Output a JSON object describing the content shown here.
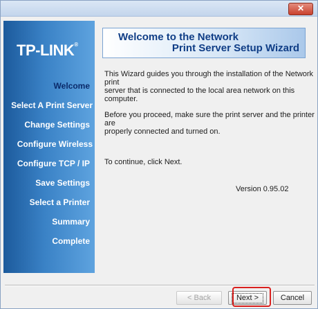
{
  "window": {
    "close_label": "✕"
  },
  "sidebar": {
    "logo": "TP-LINK",
    "logo_mark": "®",
    "steps": [
      {
        "label": "Welcome",
        "active": true
      },
      {
        "label": "Select A Print Server"
      },
      {
        "label": "Change Settings"
      },
      {
        "label": "Configure Wireless"
      },
      {
        "label": "Configure TCP / IP"
      },
      {
        "label": "Save Settings"
      },
      {
        "label": "Select a Printer"
      },
      {
        "label": "Summary"
      },
      {
        "label": "Complete"
      }
    ]
  },
  "header": {
    "title_line1": "Welcome to the Network",
    "title_line2": "Print Server Setup Wizard"
  },
  "body": {
    "para1_line1": "This Wizard guides you through the installation of the Network print",
    "para1_line2": "server that is connected to the local area network on this computer.",
    "para2_line1": "Before you proceed, make sure the print server and the printer are",
    "para2_line2": "properly connected and turned on.",
    "para3": "To continue, click Next.",
    "version": "Version 0.95.02"
  },
  "buttons": {
    "back": "< Back",
    "next": "Next >",
    "cancel": "Cancel"
  },
  "colors": {
    "highlight": "#d9201e",
    "sidebar_dark": "#1c5a9c",
    "title_blue": "#0f3d86"
  }
}
